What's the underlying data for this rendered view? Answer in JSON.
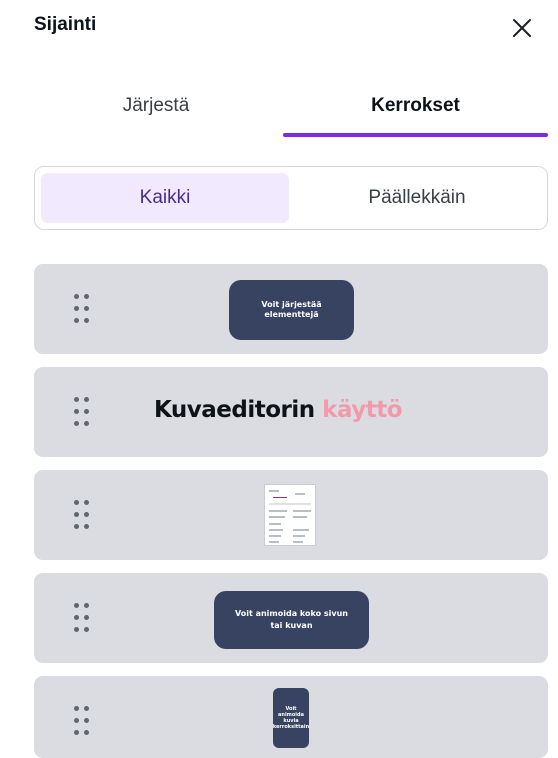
{
  "header": {
    "title": "Sijainti",
    "close_icon": "close-icon"
  },
  "tabs": [
    {
      "label": "Järjestä",
      "active": false
    },
    {
      "label": "Kerrokset",
      "active": true
    }
  ],
  "filter": [
    {
      "label": "Kaikki",
      "selected": true
    },
    {
      "label": "Päällekkäin",
      "selected": false
    }
  ],
  "layers": [
    {
      "thumbnail_text": "Voit järjestää elementtejä"
    },
    {
      "thumbnail_text": "Kuvaeditorin",
      "thumbnail_accent": "käyttö"
    },
    {
      "thumbnail_kind": "panel-screenshot"
    },
    {
      "thumbnail_text": "Voit animoida koko sivun tai kuvan"
    },
    {
      "thumbnail_text": "Voit animoida kuvia kerroksittain"
    }
  ],
  "colors": {
    "accent": "#7d2ae8",
    "selected_segment": "#f1eaff",
    "layer_bg": "#dadce1",
    "thumbnail_pill": "#384362",
    "heading_accent": "#f29aaa"
  }
}
